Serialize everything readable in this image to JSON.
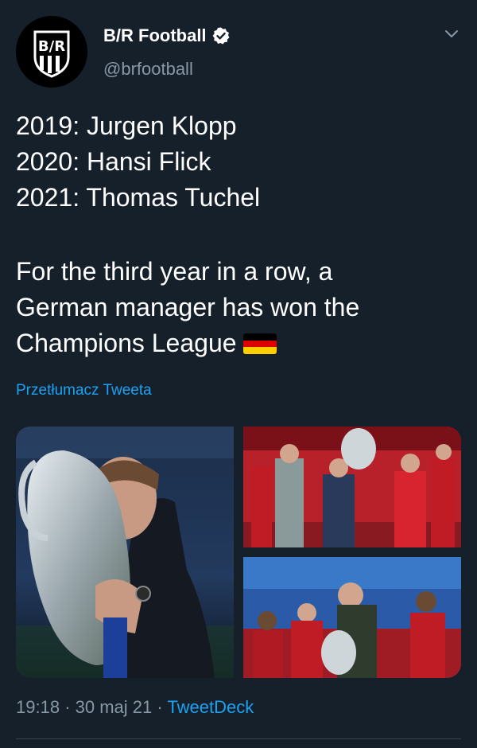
{
  "account": {
    "display_name": "B/R Football",
    "handle": "@brfootball",
    "avatar_text": "B/R"
  },
  "tweet": {
    "lines": [
      "2019: Jurgen Klopp",
      "2020: Hansi Flick",
      "2021: Thomas Tuchel"
    ],
    "body_lines": [
      "For the third year in a row, a",
      "German manager has won the",
      "Champions League"
    ],
    "translate_label": "Przetłumacz Tweeta"
  },
  "meta": {
    "time": "19:18",
    "date": "30 maj 21",
    "separator": "·",
    "source": "TweetDeck"
  },
  "colors": {
    "background": "#15202b",
    "accent": "#1da1f2",
    "secondary_text": "#8899a6",
    "divider": "#38444d"
  }
}
